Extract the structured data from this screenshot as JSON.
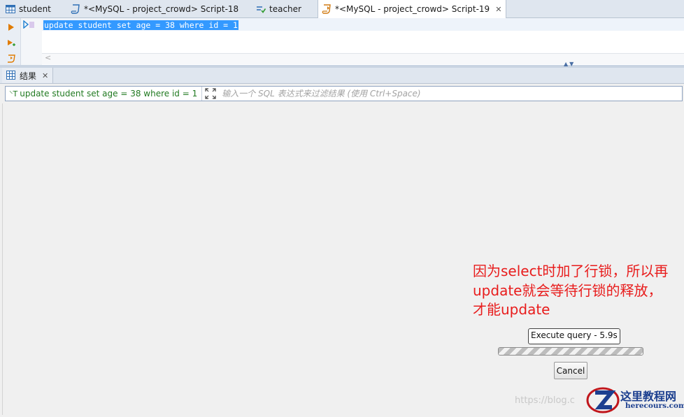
{
  "tabs": [
    {
      "label": "student",
      "icon": "table-icon",
      "active": false
    },
    {
      "label": "*<MySQL - project_crowd> Script-18",
      "icon": "sql-script-icon",
      "active": false
    },
    {
      "label": "teacher",
      "icon": "view-icon",
      "active": false
    },
    {
      "label": "*<MySQL - project_crowd> Script-19",
      "icon": "sql-script-icon",
      "active": true
    }
  ],
  "editor": {
    "line1": "update student set age = 38 where id = 1",
    "scroll_left_arrow": "<"
  },
  "results": {
    "tab_label": "结果",
    "query_text": "update student set age = 38 where id = 1",
    "filter_placeholder": "输入一个 SQL 表达式来过滤结果 (使用 Ctrl+Space)"
  },
  "annotation": {
    "text": "因为select时加了行锁，所以再update就会等待行锁的释放，才能update",
    "color": "#e81c1c"
  },
  "execution": {
    "label": "Execute query - 5.9s",
    "cancel_label": "Cancel"
  },
  "watermark": {
    "text": "https://blog.c"
  },
  "logo": {
    "name": "这里教程网",
    "url": "herecours.com"
  },
  "colors": {
    "selection": "#3399ff",
    "query_text": "#217a21",
    "tabbar_bg": "#dfe6ef"
  }
}
